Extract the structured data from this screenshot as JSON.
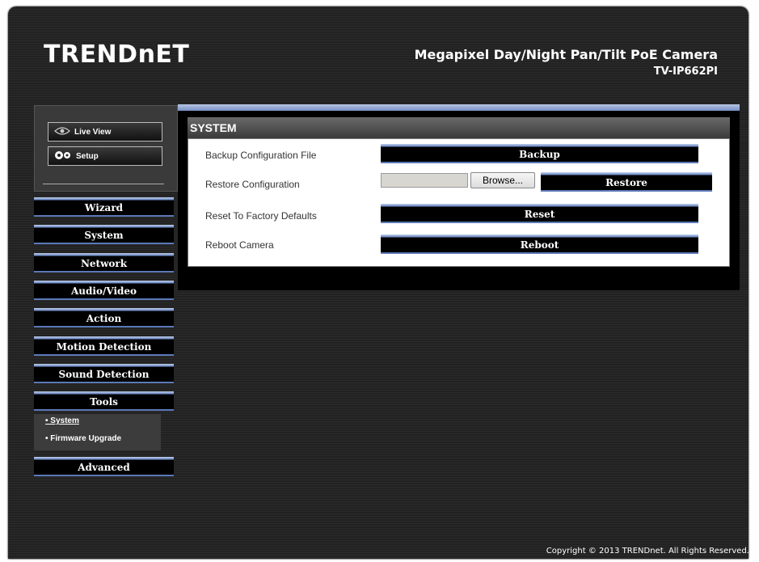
{
  "header": {
    "logo": "TRENDnET",
    "product_title": "Megapixel Day/Night Pan/Tilt PoE Camera",
    "model": "TV-IP662PI"
  },
  "sidebar": {
    "live_view_label": "Live View",
    "setup_label": "Setup",
    "nav": [
      {
        "label": "Wizard"
      },
      {
        "label": "System"
      },
      {
        "label": "Network"
      },
      {
        "label": "Audio/Video"
      },
      {
        "label": "Action"
      },
      {
        "label": "Motion Detection"
      },
      {
        "label": "Sound Detection"
      },
      {
        "label": "Tools"
      },
      {
        "label": "Advanced"
      }
    ],
    "tools_submenu": [
      {
        "label": "• System"
      },
      {
        "label": "• Firmware Upgrade"
      }
    ]
  },
  "panel": {
    "title": "SYSTEM",
    "rows": [
      {
        "label": "Backup Configuration File",
        "button": "Backup"
      },
      {
        "label": "Restore Configuration",
        "browse": "Browse...",
        "button": "Restore"
      },
      {
        "label": "Reset To Factory Defaults",
        "button": "Reset"
      },
      {
        "label": "Reboot Camera",
        "button": "Reboot"
      }
    ]
  },
  "footer": {
    "copyright": "Copyright © 2013 TRENDnet. All Rights Reserved."
  },
  "colors": {
    "accent_blue": "#6a87c4",
    "background": "#222222"
  },
  "icons": {
    "live_view": "eye-icon",
    "setup": "gear-icon"
  }
}
